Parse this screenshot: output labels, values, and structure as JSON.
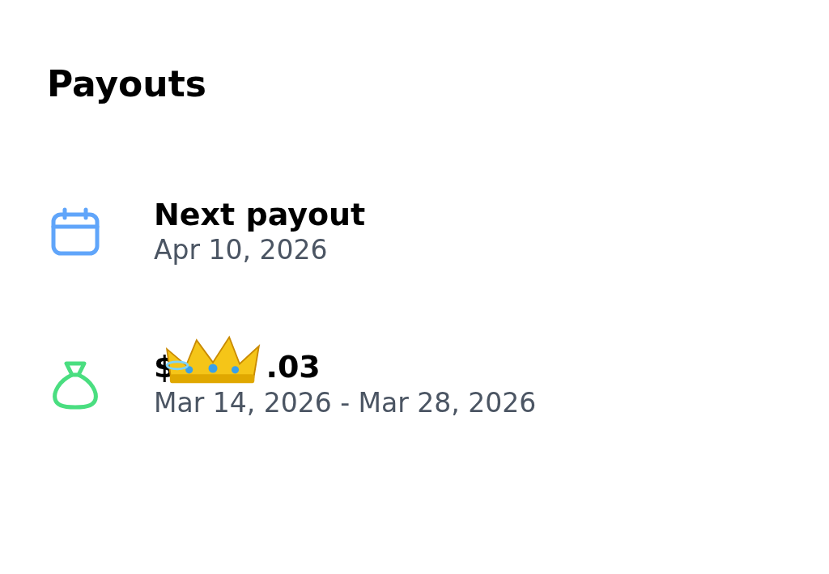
{
  "title": "Payouts",
  "items": [
    {
      "kind": "calendar",
      "title": "Next payout",
      "subtitle": "Apr 10, 2026"
    },
    {
      "kind": "money-bag",
      "title_start": "$",
      "title_end": ".03",
      "subtitle": "Mar 14, 2026 - Mar 28, 2026"
    }
  ]
}
